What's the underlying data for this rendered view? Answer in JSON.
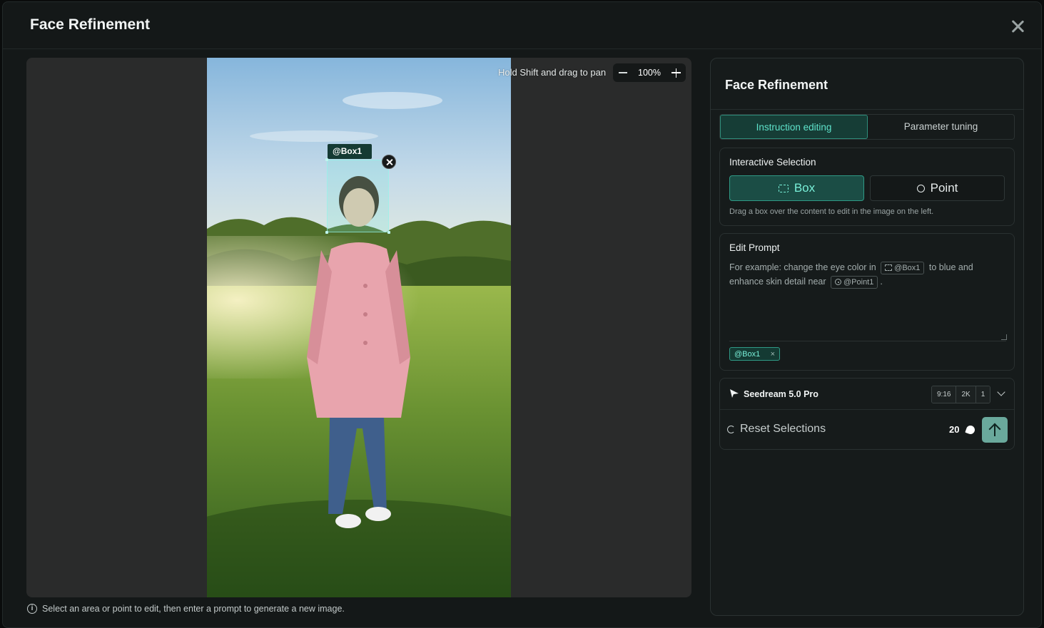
{
  "modal": {
    "title": "Face Refinement"
  },
  "canvas": {
    "pan_hint": "Hold Shift and drag to pan",
    "zoom_level": "100%",
    "selection_tag": "@Box1"
  },
  "footer": {
    "hint": "Select an area or point to edit, then enter a prompt to generate a new image."
  },
  "panel": {
    "title": "Face Refinement",
    "tabs": [
      {
        "label": "Instruction editing",
        "active": true
      },
      {
        "label": "Parameter tuning",
        "active": false
      }
    ],
    "interactive_selection": {
      "label": "Interactive Selection",
      "box_label": "Box",
      "point_label": "Point",
      "hint": "Drag a box over the content to edit in the image on the left."
    },
    "edit_prompt": {
      "label": "Edit Prompt",
      "placeholder_part1": "For example: change the eye color in",
      "chip_box": "@Box1",
      "placeholder_part2": "to blue and enhance skin detail near",
      "chip_point": "@Point1",
      "placeholder_end": ".",
      "tag": "@Box1",
      "tag_remove": "×"
    },
    "model": {
      "name": "Seedream 5.0 Pro",
      "params": [
        "9:16",
        "2K",
        "1"
      ]
    },
    "reset_label": "Reset Selections",
    "credits": "20"
  },
  "colors": {
    "accent": "#5fe3cb",
    "accent_bg": "#163d36",
    "send_button": "#6aa99c"
  },
  "icons": [
    "close-icon",
    "minus-icon",
    "plus-icon",
    "remove-selection-icon",
    "info-icon",
    "box-icon",
    "point-icon",
    "model-icon",
    "chevron-down-icon",
    "reset-icon",
    "credit-icon",
    "arrow-up-icon"
  ]
}
